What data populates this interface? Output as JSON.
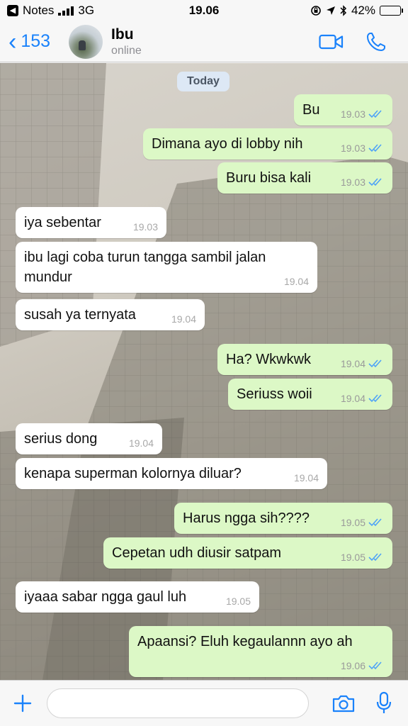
{
  "status_bar": {
    "back_app": "Notes",
    "network": "3G",
    "time": "19.06",
    "battery": "42%",
    "battery_level": 0.42
  },
  "header": {
    "back_count": "153",
    "contact_name": "Ibu",
    "contact_status": "online"
  },
  "chat": {
    "date_label": "Today",
    "messages": [
      {
        "dir": "out",
        "text": "Bu",
        "time": "19.03"
      },
      {
        "dir": "out",
        "text": "Dimana ayo di lobby nih",
        "time": "19.03"
      },
      {
        "dir": "out",
        "text": "Buru bisa kali",
        "time": "19.03"
      },
      {
        "dir": "in",
        "text": "iya sebentar",
        "time": "19.03"
      },
      {
        "dir": "in",
        "text": "ibu lagi coba turun tangga sambil jalan mundur",
        "time": "19.04"
      },
      {
        "dir": "in",
        "text": "susah ya ternyata",
        "time": "19.04"
      },
      {
        "dir": "out",
        "text": "Ha? Wkwkwk",
        "time": "19.04"
      },
      {
        "dir": "out",
        "text": "Seriuss woii",
        "time": "19.04"
      },
      {
        "dir": "in",
        "text": "serius dong",
        "time": "19.04"
      },
      {
        "dir": "in",
        "text": "kenapa superman kolornya diluar?",
        "time": "19.04"
      },
      {
        "dir": "out",
        "text": "Harus ngga sih????",
        "time": "19.05"
      },
      {
        "dir": "out",
        "text": "Cepetan udh diusir satpam",
        "time": "19.05"
      },
      {
        "dir": "in",
        "text": "iyaaa sabar ngga gaul luh",
        "time": "19.05"
      },
      {
        "dir": "out",
        "text": "Apaansi? Eluh kegaulannn ayo ah",
        "time": "19.06"
      }
    ]
  },
  "input_bar": {
    "placeholder": ""
  },
  "colors": {
    "accent": "#1a82fb",
    "outgoing_bubble": "#dcf8c6",
    "incoming_bubble": "#ffffff",
    "read_tick": "#4fa3f7"
  }
}
